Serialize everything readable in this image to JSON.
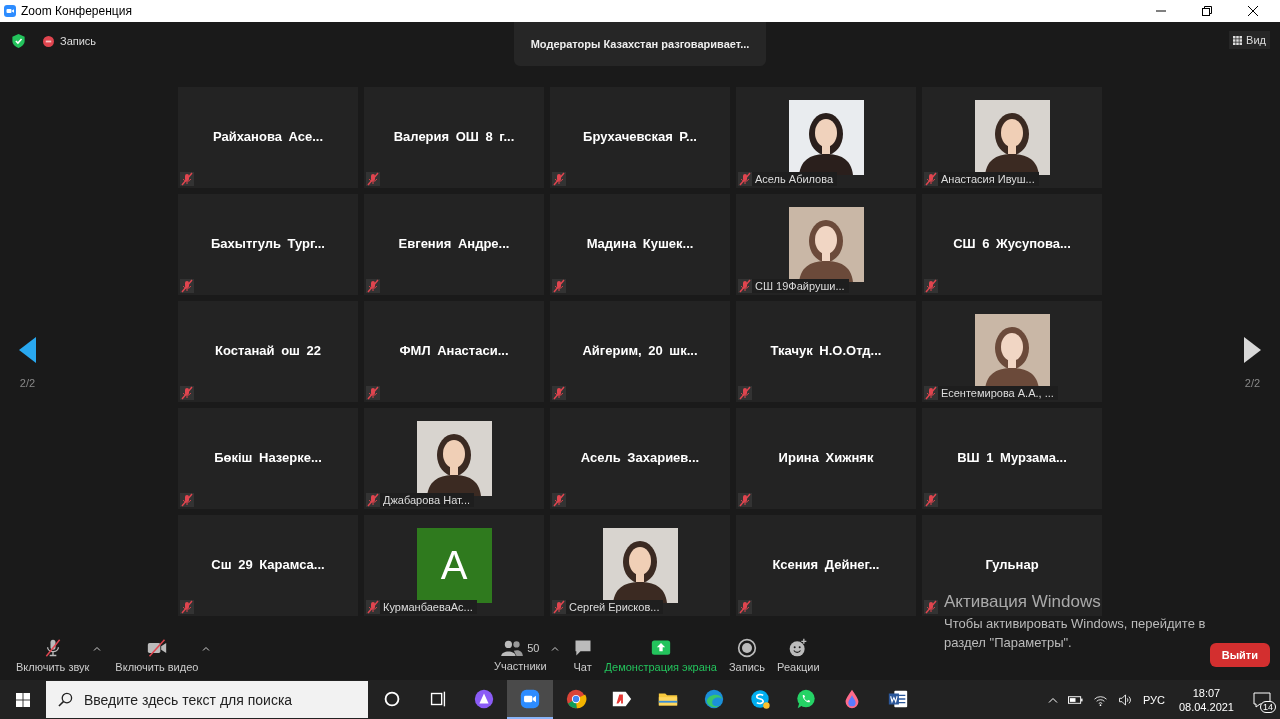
{
  "window": {
    "title": "Zoom Конференция"
  },
  "top_bar": {
    "recording_label": "Запись",
    "meeting_topic": "Модераторы Казахстан разговаривает...",
    "view_button": "Вид"
  },
  "pager": {
    "left": "2/2",
    "right": "2/2"
  },
  "tiles": [
    {
      "kind": "name",
      "name": "Райханова Асе...",
      "muted": true
    },
    {
      "kind": "name",
      "name": "Валерия ОШ 8 г...",
      "muted": true
    },
    {
      "kind": "name",
      "name": "Брухачевская Р...",
      "muted": true
    },
    {
      "name": "Асель Абилова",
      "muted": true
    },
    {
      "name": "Анастасия Ивуш...",
      "muted": true
    },
    {
      "kind": "name",
      "name": "Бахытгуль Тург...",
      "muted": true
    },
    {
      "kind": "name",
      "name": "Евгения Андре...",
      "muted": true
    },
    {
      "kind": "name",
      "name": "Мадина Кушек...",
      "muted": true
    },
    {
      "name": "СШ 19Файруши...",
      "muted": true
    },
    {
      "kind": "name",
      "name": "СШ 6 Жусупова...",
      "muted": true
    },
    {
      "kind": "name",
      "name": "Костанай ош 22",
      "muted": true
    },
    {
      "kind": "name",
      "name": "ФМЛ Анастаси...",
      "muted": true
    },
    {
      "kind": "name",
      "name": "Айгерим, 20 шк...",
      "muted": true
    },
    {
      "kind": "name",
      "name": "Ткачук Н.О.Отд...",
      "muted": true
    },
    {
      "name": "Есентемирова А.А., ...",
      "muted": true
    },
    {
      "kind": "name",
      "name": "Бөкіш Назерке...",
      "muted": true
    },
    {
      "name": "Джабарова Нат...",
      "muted": true
    },
    {
      "kind": "name",
      "name": "Асель Захариев...",
      "muted": true
    },
    {
      "kind": "name",
      "name": "Ирина Хижняк",
      "muted": true
    },
    {
      "kind": "name",
      "name": "ВШ 1 Мурзама...",
      "muted": true
    },
    {
      "kind": "name",
      "name": "Сш 29 Карамса...",
      "muted": true
    },
    {
      "kind": "avatar",
      "letter": "A",
      "name": "КурманбаеваАс...",
      "muted": true
    },
    {
      "name": "Сергей Ерисков...",
      "muted": true
    },
    {
      "kind": "name",
      "name": "Ксения Дейнег...",
      "muted": true
    },
    {
      "kind": "name",
      "name": "Гульнар",
      "muted": true
    }
  ],
  "toolbar": {
    "audio": "Включить звук",
    "video": "Включить видео",
    "participants": {
      "label": "Участники",
      "count": "50"
    },
    "chat": "Чат",
    "share": "Демонстрация экрана",
    "record": "Запись",
    "reactions": "Реакции",
    "leave": "Выйти"
  },
  "activation": {
    "title": "Активация Windows",
    "text": "Чтобы активировать Windows, перейдите в раздел \"Параметры\"."
  },
  "taskbar": {
    "search_placeholder": "Введите здесь текст для поиска",
    "apps": [
      {
        "kind": "cortana",
        "selected": false
      },
      {
        "kind": "taskview",
        "selected": false
      },
      {
        "kind": "alice",
        "selected": false
      },
      {
        "kind": "zoom",
        "selected": true
      },
      {
        "kind": "chrome",
        "selected": false
      },
      {
        "kind": "yandex",
        "selected": false
      },
      {
        "kind": "explorer",
        "selected": false
      },
      {
        "kind": "edge",
        "selected": false
      },
      {
        "kind": "skype",
        "selected": false
      },
      {
        "kind": "whatsapp",
        "selected": false
      },
      {
        "kind": "drop",
        "selected": false
      },
      {
        "kind": "word",
        "selected": false
      }
    ],
    "language": "РУС",
    "time": "18:07",
    "date": "08.04.2021",
    "notifications": "14"
  }
}
